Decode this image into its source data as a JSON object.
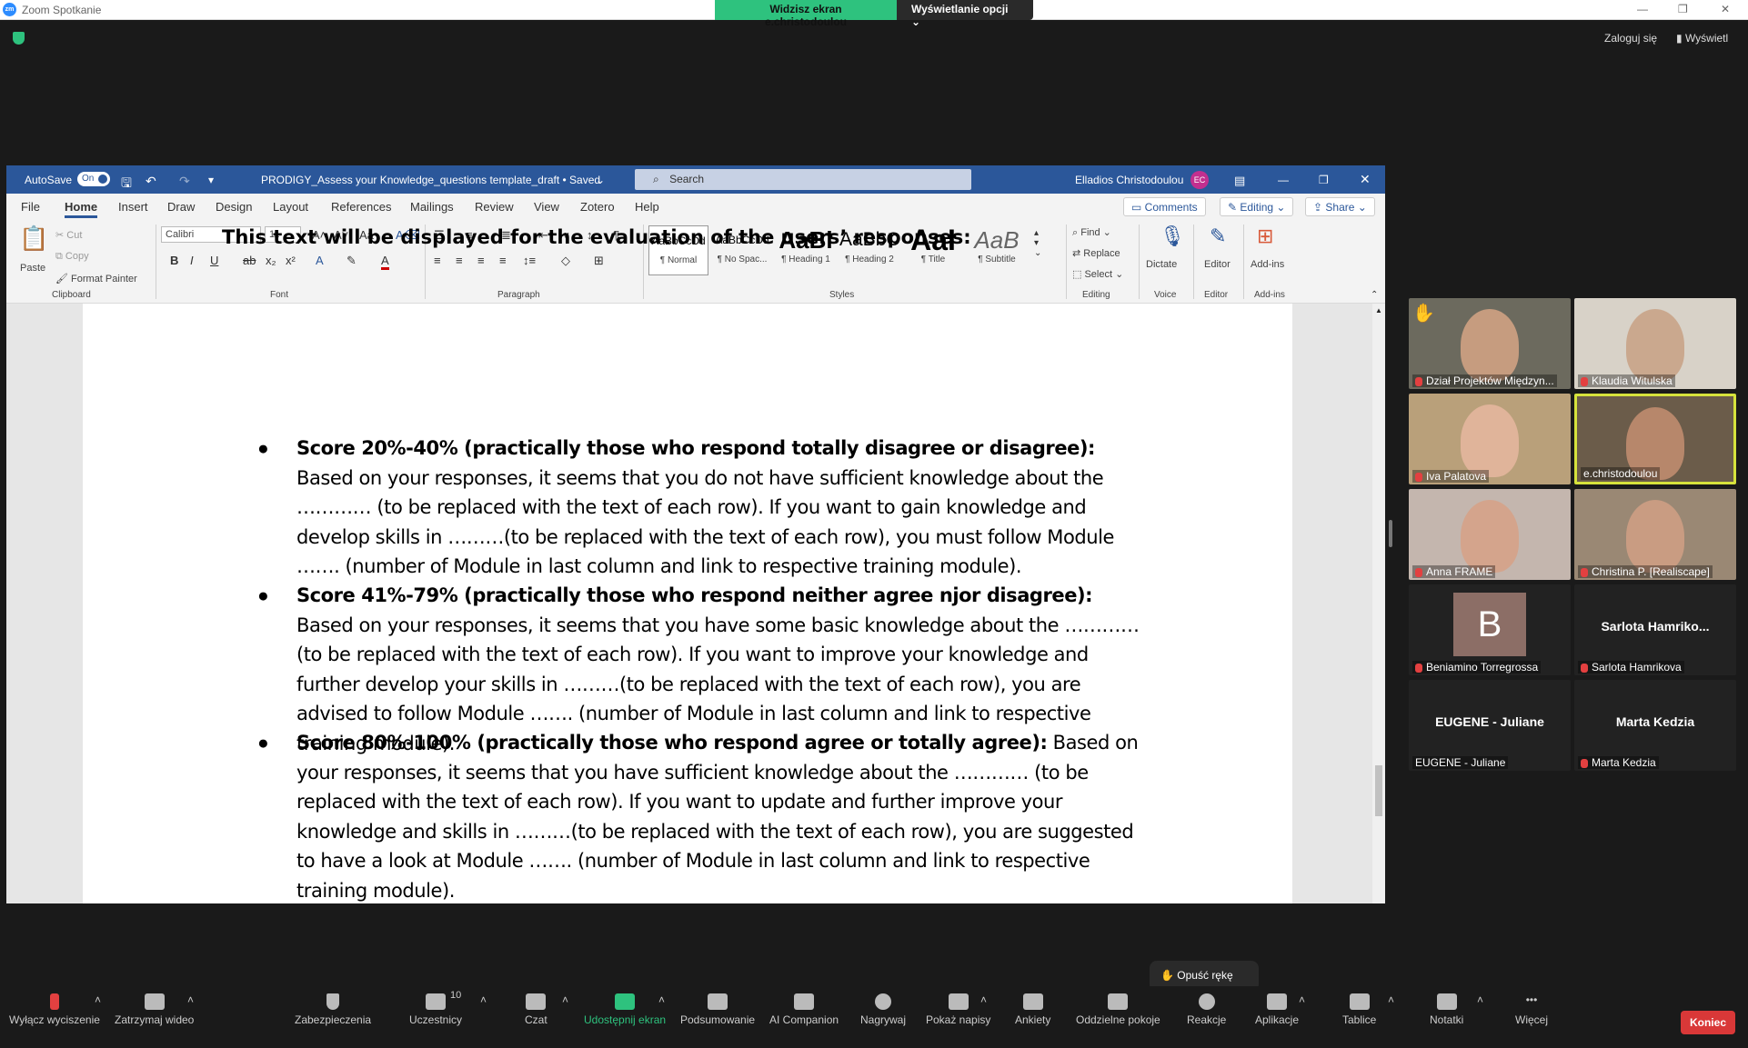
{
  "zoom": {
    "window_title": "Zoom Spotkanie",
    "share_banner": "Widzisz ekran e.christodoulou",
    "view_options": "Wyświetlanie opcji",
    "login": "Zaloguj się",
    "view": "Wyświetl"
  },
  "word": {
    "autosave_label": "AutoSave",
    "autosave_state": "On",
    "doc_title": "PRODIGY_Assess your Knowledge_questions template_draft • Saved",
    "search_placeholder": "Search",
    "user_name": "Elladios Christodoulou",
    "user_initials": "EC",
    "tabs": [
      "File",
      "Home",
      "Insert",
      "Draw",
      "Design",
      "Layout",
      "References",
      "Mailings",
      "Review",
      "View",
      "Zotero",
      "Help"
    ],
    "comments_btn": "Comments",
    "editing_btn": "Editing",
    "share_btn": "Share",
    "ribbon": {
      "paste": "Paste",
      "cut": "Cut",
      "copy": "Copy",
      "format_painter": "Format Painter",
      "clipboard": "Clipboard",
      "font_name": "Calibri",
      "font_size": "11",
      "font": "Font",
      "paragraph": "Paragraph",
      "styles": [
        {
          "preview": "AaBbCcDd",
          "label": "¶ Normal"
        },
        {
          "preview": "AaBbCcDd",
          "label": "¶ No Spac..."
        },
        {
          "preview": "AaBl",
          "label": "¶ Heading 1"
        },
        {
          "preview": "AaBbC",
          "label": "¶ Heading 2"
        },
        {
          "preview": "AaI",
          "label": "¶ Title"
        },
        {
          "preview": "AaB",
          "label": "¶ Subtitle"
        }
      ],
      "styles_label": "Styles",
      "find": "Find",
      "replace": "Replace",
      "select": "Select",
      "editing_label": "Editing",
      "dictate": "Dictate",
      "voice_label": "Voice",
      "editor": "Editor",
      "editor_label": "Editor",
      "addins": "Add-ins",
      "addins_label": "Add-ins"
    },
    "document": {
      "heading": "This text will be displayed for the evaluation of the users’ responses:",
      "items": [
        {
          "bold": "Score 20%-40% (practically those who respond totally disagree or disagree):",
          "text": " Based on your responses, it seems that you do not have sufficient knowledge about the ………… (to be replaced with the text of each row). If you want to gain knowledge and develop skills in ………(to be replaced with the text of each row), you must follow Module …….  (number of Module in last column and link to respective training module)."
        },
        {
          "bold": "Score 41%-79% (practically those who respond neither agree njor disagree):",
          "text": " Based on your responses, it seems that you have some basic knowledge about the ………… (to be replaced with the text of each row). If you want to improve your knowledge and further develop your skills in ………(to be replaced with the text of each row), you are advised to follow Module …….  (number of Module in last column and link to respective training module)."
        },
        {
          "bold": "Score 80%-100% (practically those who respond agree or totally agree):",
          "text": " Based on your responses, it seems that you have sufficient knowledge about the ………… (to be replaced with the text of each row). If you want to update and further improve your knowledge and skills in ………(to be replaced with the text of each row), you are suggested to have a look at Module …….  (number of Module in last column and link to respective training module)."
        }
      ]
    }
  },
  "participants": [
    {
      "name": "Dział Projektów Międzyn...",
      "video": true,
      "hand": true
    },
    {
      "name": "Klaudia Witulska",
      "video": true
    },
    {
      "name": "Iva Palatova",
      "video": true
    },
    {
      "name": "e.christodoulou",
      "video": true,
      "active": true
    },
    {
      "name": "Anna FRAME",
      "video": true
    },
    {
      "name": "Christina P. [Realiscape]",
      "video": true
    },
    {
      "name": "Beniamino Torregrossa",
      "avatar": "B"
    },
    {
      "name": "Sarlota Hamrikova",
      "display": "Sarlota  Hamriko..."
    },
    {
      "name": "EUGENE - Juliane",
      "display": "EUGENE - Juliane"
    },
    {
      "name": "Marta Kedzia",
      "display": "Marta Kedzia"
    }
  ],
  "toolbar": {
    "items": [
      "Wyłącz wyciszenie",
      "Zatrzymaj wideo",
      "Zabezpieczenia",
      "Uczestnicy",
      "Czat",
      "Udostępnij ekran",
      "Podsumowanie",
      "AI Companion",
      "Nagrywaj",
      "Pokaż napisy",
      "Ankiety",
      "Oddzielne pokoje",
      "Reakcje",
      "Aplikacje",
      "Tablice",
      "Notatki",
      "Więcej"
    ],
    "participants_count": "10",
    "raise_hand": "Opuść rękę",
    "end": "Koniec"
  },
  "colors": {
    "word_blue": "#2b579a",
    "zoom_green": "#2ec27e",
    "end_red": "#d93838"
  }
}
